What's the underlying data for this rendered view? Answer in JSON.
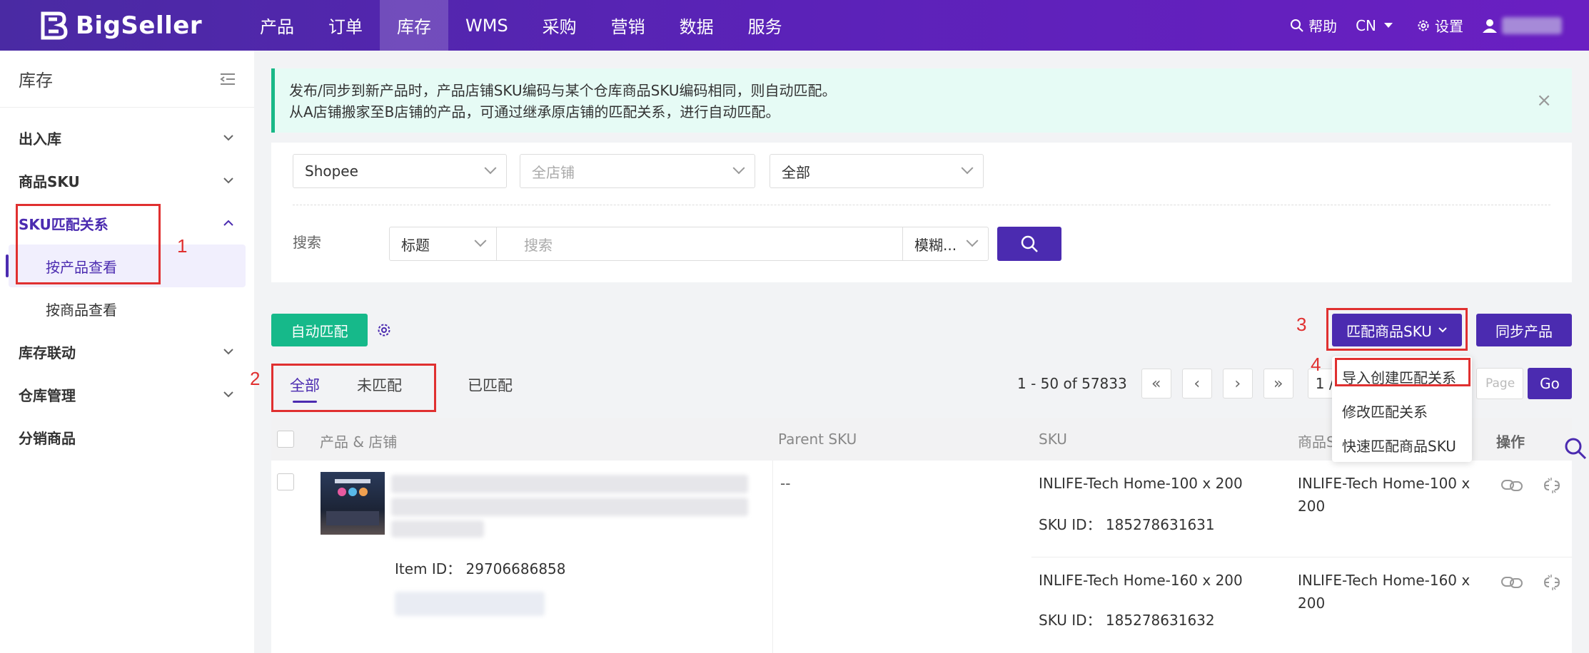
{
  "brand": {
    "logo_text": "BigSeller",
    "accent": "#4b2bb0",
    "topbar": "#5b22b8",
    "green": "#16b98a"
  },
  "topnav": {
    "items": [
      {
        "label": "产品"
      },
      {
        "label": "订单"
      },
      {
        "label": "库存"
      },
      {
        "label": "WMS"
      },
      {
        "label": "采购"
      },
      {
        "label": "营销"
      },
      {
        "label": "数据"
      },
      {
        "label": "服务"
      }
    ],
    "active": "库存",
    "help": "帮助",
    "lang": "CN",
    "settings": "设置"
  },
  "sidebar": {
    "title": "库存",
    "groups": [
      {
        "label": "出入库"
      },
      {
        "label": "商品SKU"
      },
      {
        "label": "SKU匹配关系",
        "subs": [
          "按产品查看",
          "按商品查看"
        ]
      },
      {
        "label": "库存联动"
      },
      {
        "label": "仓库管理"
      },
      {
        "label": "分销商品"
      }
    ]
  },
  "alert": {
    "line1": "发布/同步到新产品时，产品店铺SKU编码与某个仓库商品SKU编码相同，则自动匹配。",
    "line2": "从A店铺搬家至B店铺的产品，可通过继承原店铺的匹配关系，进行自动匹配。",
    "close": "×"
  },
  "filters": {
    "platform": "Shopee",
    "store_placeholder": "全店铺",
    "status": "全部",
    "search_label": "搜索",
    "search_field": "标题",
    "search_placeholder": "搜索",
    "match_mode": "模糊..."
  },
  "actions": {
    "auto_match": "自动匹配",
    "match_sku": "匹配商品SKU",
    "sync": "同步产品"
  },
  "dropdown": {
    "items": [
      "导入创建匹配关系",
      "修改匹配关系",
      "快速匹配商品SKU"
    ]
  },
  "tabs": [
    "全部",
    "未匹配",
    "已匹配"
  ],
  "pagination": {
    "summary": "1 - 50 of 57833",
    "first": "«",
    "prev": "‹",
    "next": "›",
    "last": "»",
    "current": "1 / 1",
    "page_placeholder": "Page",
    "go": "Go"
  },
  "table": {
    "headers": {
      "product": "产品 & 店铺",
      "parent": "Parent SKU",
      "sku": "SKU",
      "goods": "商品S",
      "ops": "操作"
    },
    "row": {
      "item_id": "Item ID：  29706686858",
      "parent": "--",
      "skus": [
        {
          "sku": "INLIFE-Tech Home-100 x 200",
          "sku_id": "SKU ID：  185278631631",
          "goods1": "INLIFE-Tech Home-100 x",
          "goods2": "200"
        },
        {
          "sku": "INLIFE-Tech Home-160 x 200",
          "sku_id": "SKU ID：  185278631632",
          "goods1": "INLIFE-Tech Home-160 x",
          "goods2": "200"
        }
      ]
    }
  },
  "annotations": [
    "1",
    "2",
    "3",
    "4"
  ]
}
